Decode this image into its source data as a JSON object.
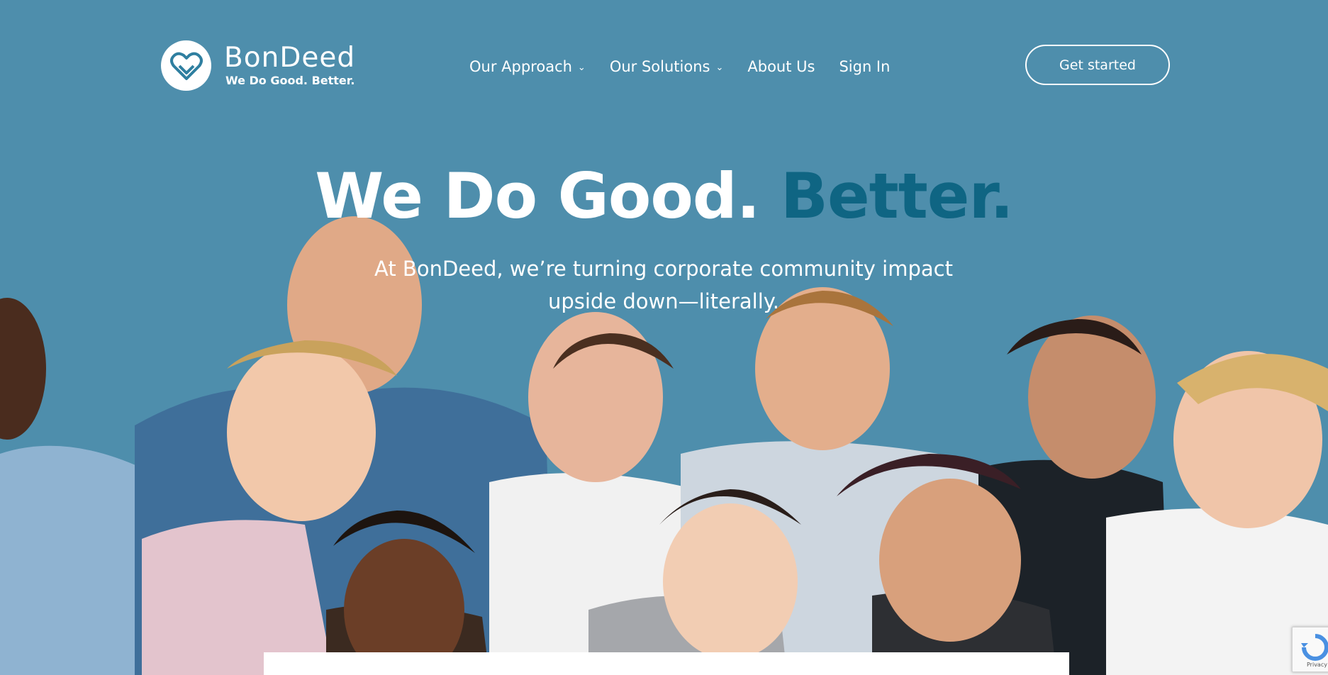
{
  "brand": {
    "name": "BonDeed",
    "tagline": "We Do Good. Better."
  },
  "nav": {
    "items": [
      {
        "label": "Our Approach",
        "has_dropdown": true
      },
      {
        "label": "Our Solutions",
        "has_dropdown": true
      },
      {
        "label": "About Us",
        "has_dropdown": false
      },
      {
        "label": "Sign In",
        "has_dropdown": false
      }
    ],
    "cta_label": "Get started"
  },
  "hero": {
    "headline_part1": "We Do Good.",
    "headline_part2": "Better.",
    "subheadline": "At BonDeed, we’re turning corporate community impact upside down—literally."
  },
  "recaptcha": {
    "label": "Privacy - Terms"
  },
  "colors": {
    "background": "#4e8eac",
    "accent": "#0f6583",
    "text": "#ffffff"
  }
}
